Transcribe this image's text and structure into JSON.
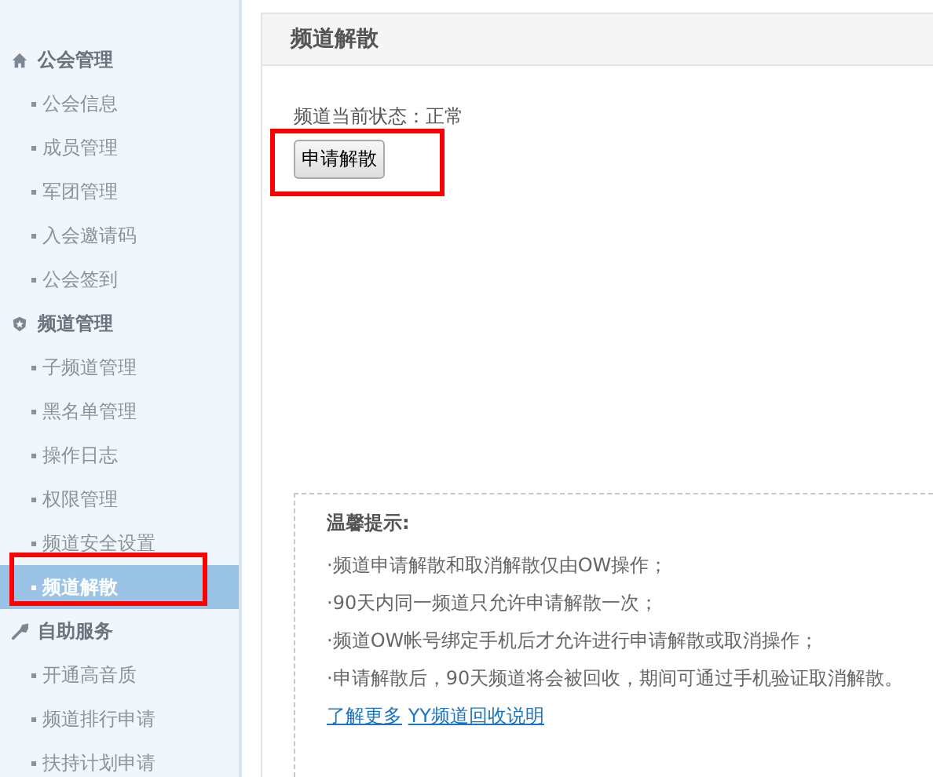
{
  "sidebar": {
    "groups": [
      {
        "title": "公会管理",
        "items": [
          {
            "label": "公会信息",
            "selected": false,
            "highlighted": false
          },
          {
            "label": "成员管理",
            "selected": false,
            "highlighted": false
          },
          {
            "label": "军团管理",
            "selected": false,
            "highlighted": false
          },
          {
            "label": "入会邀请码",
            "selected": false,
            "highlighted": false
          },
          {
            "label": "公会签到",
            "selected": false,
            "highlighted": false
          }
        ]
      },
      {
        "title": "频道管理",
        "items": [
          {
            "label": "子频道管理",
            "selected": false,
            "highlighted": false
          },
          {
            "label": "黑名单管理",
            "selected": false,
            "highlighted": false
          },
          {
            "label": "操作日志",
            "selected": false,
            "highlighted": false
          },
          {
            "label": "权限管理",
            "selected": false,
            "highlighted": false
          },
          {
            "label": "频道安全设置",
            "selected": false,
            "highlighted": false
          },
          {
            "label": "频道解散",
            "selected": true,
            "highlighted": true
          }
        ]
      },
      {
        "title": "自助服务",
        "items": [
          {
            "label": "开通高音质",
            "selected": false,
            "highlighted": false
          },
          {
            "label": "频道排行申请",
            "selected": false,
            "highlighted": false
          },
          {
            "label": "扶持计划申请",
            "selected": false,
            "highlighted": false
          }
        ]
      }
    ]
  },
  "panel": {
    "title": "频道解散",
    "status": "频道当前状态：正常",
    "button": {
      "label": "申请解散",
      "highlighted": true
    }
  },
  "tips": {
    "title": "温馨提示:",
    "lines": [
      "·频道申请解散和取消解散仅由OW操作；",
      "·90天内同一频道只允许申请解散一次；",
      "·频道OW帐号绑定手机后才允许进行申请解散或取消操作；",
      "·申请解散后，90天频道将会被回收，期间可通过手机验证取消解散。"
    ],
    "link_prefix": "了解更多",
    "link": "YY频道回收说明"
  }
}
